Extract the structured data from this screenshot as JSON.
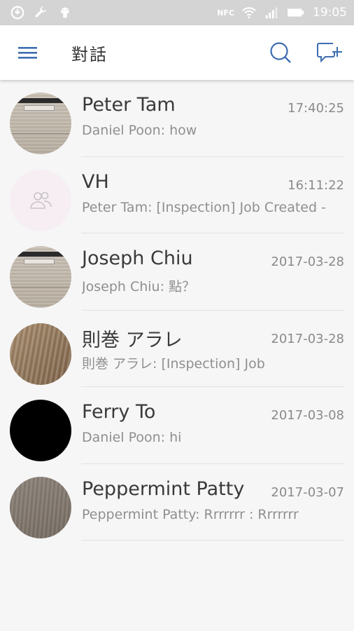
{
  "status_bar": {
    "time": "19:05",
    "icons": [
      "sync-icon",
      "wrench-icon",
      "android-icon",
      "nfc-icon",
      "wifi-icon",
      "signal-icon",
      "battery-icon"
    ],
    "nfc_label": "NFC"
  },
  "app_bar": {
    "title": "對話",
    "accent_color": "#3d6eb0",
    "icons": [
      "menu-icon",
      "search-icon",
      "new-chat-icon"
    ]
  },
  "conversations": [
    {
      "name": "Peter Tam",
      "time": "17:40:25",
      "preview": "Daniel Poon: how",
      "avatar": "paper-photo"
    },
    {
      "name": "VH",
      "time": "16:11:22",
      "preview": "Peter Tam: [Inspection] Job Created -",
      "avatar": "group-placeholder-icon"
    },
    {
      "name": "Joseph Chiu",
      "time": "2017-03-28",
      "preview": "Joseph Chiu: 點？",
      "avatar": "paper-photo"
    },
    {
      "name": "則巻 アラレ",
      "time": "2017-03-28",
      "preview": "則巻 アラレ: [Inspection] Job",
      "avatar": "wood-photo"
    },
    {
      "name": "Ferry To",
      "time": "2017-03-08",
      "preview": "Daniel Poon: hi",
      "avatar": "black-photo"
    },
    {
      "name": "Peppermint Patty",
      "time": "2017-03-07",
      "preview": "Peppermint Patty: Rrrrrrr : Rrrrrrr",
      "avatar": "gray-photo"
    }
  ]
}
